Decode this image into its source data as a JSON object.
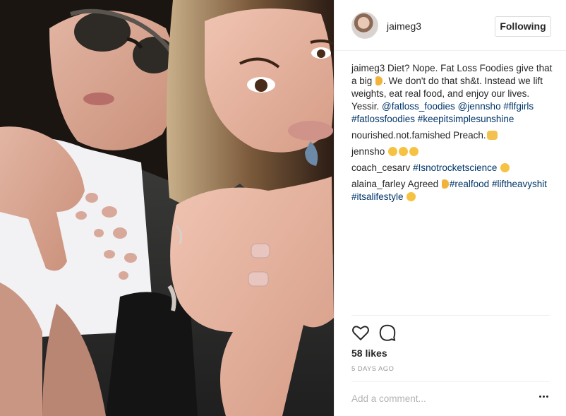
{
  "post": {
    "username": "jaimeg3",
    "follow_label": "Following",
    "caption": {
      "user": "jaimeg3",
      "text_a": "Diet? Nope. Fat Loss Foodies give that a big",
      "emoji_a": "thumbs-down-emoji",
      "text_b": ". We don't do that sh&t. Instead we lift weights, eat real food, and enjoy our lives. Yessir.",
      "mention_1": "@fatloss_foodies",
      "mention_2": "@jennsho",
      "hashtags": "#flfgirls #fatlossfoodies #keepitsimplesunshine"
    },
    "comments": [
      {
        "user": "nourished.not.famished",
        "text": "Preach.",
        "emoji": "raised-hands-emoji"
      },
      {
        "user": "jennsho",
        "text": "",
        "emoji": "kissing-face-emoji x3"
      },
      {
        "user": "coach_cesarv",
        "tag": "#Isnotrocketscience",
        "emoji": "wink-emoji"
      },
      {
        "user": "alaina_farley",
        "text": "Agreed",
        "tag_1": "#realfood",
        "tag_2": "#liftheavyshit",
        "tag_3": "#itsalifestyle",
        "emoji_a": "thumbs-down-emoji",
        "emoji_b": "kissing-face-emoji"
      }
    ],
    "likes": "58 likes",
    "timestamp": "5 DAYS AGO",
    "add_comment_placeholder": "Add a comment...",
    "icons": [
      "heart-icon",
      "comment-icon",
      "more-options-icon"
    ],
    "colors": {
      "link": "#003569",
      "text": "#262626",
      "muted": "#999999",
      "border": "#efefef"
    }
  }
}
